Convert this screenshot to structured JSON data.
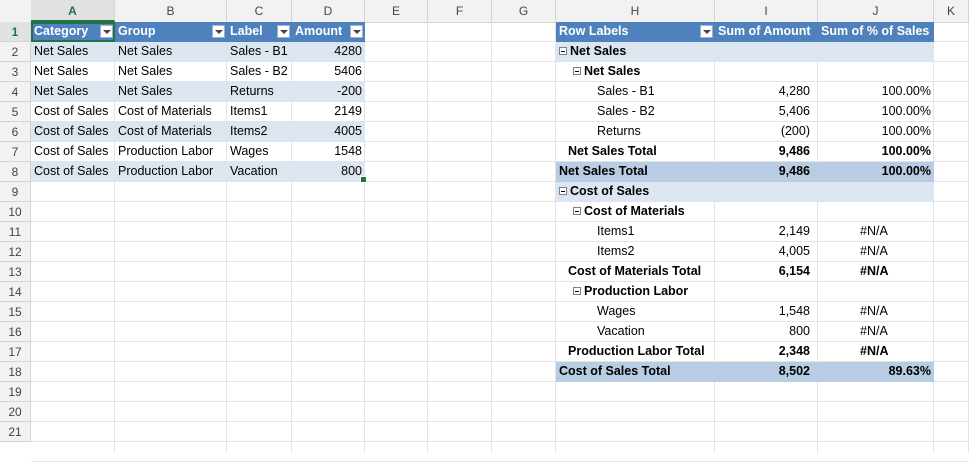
{
  "columns": [
    "A",
    "B",
    "C",
    "D",
    "E",
    "F",
    "G",
    "H",
    "I",
    "J",
    "K"
  ],
  "selected_column": "A",
  "rows": [
    "1",
    "2",
    "3",
    "4",
    "5",
    "6",
    "7",
    "8",
    "9",
    "10",
    "11",
    "12",
    "13",
    "14",
    "15",
    "16",
    "17",
    "18",
    "19",
    "20",
    "21"
  ],
  "selected_row": "1",
  "table": {
    "headers": [
      "Category",
      "Group",
      "Label",
      "Amount"
    ],
    "rows": [
      [
        "Net Sales",
        "Net Sales",
        "Sales - B1",
        "4280"
      ],
      [
        "Net Sales",
        "Net Sales",
        "Sales - B2",
        "5406"
      ],
      [
        "Net Sales",
        "Net Sales",
        "Returns",
        "-200"
      ],
      [
        "Cost of Sales",
        "Cost of Materials",
        "Items1",
        "2149"
      ],
      [
        "Cost of Sales",
        "Cost of Materials",
        "Items2",
        "4005"
      ],
      [
        "Cost of Sales",
        "Production Labor",
        "Wages",
        "1548"
      ],
      [
        "Cost of Sales",
        "Production Labor",
        "Vacation",
        "800"
      ]
    ]
  },
  "pivot": {
    "headers": [
      "Row Labels",
      "Sum of Amount",
      "Sum of % of Sales"
    ],
    "rows": [
      {
        "label": "Net Sales",
        "amount": "",
        "pct": "",
        "kind": "group"
      },
      {
        "label": "Net Sales",
        "amount": "",
        "pct": "",
        "kind": "subgroup"
      },
      {
        "label": "Sales - B1",
        "amount": "4,280",
        "pct": "100.00%",
        "kind": "item"
      },
      {
        "label": "Sales - B2",
        "amount": "5,406",
        "pct": "100.00%",
        "kind": "item"
      },
      {
        "label": "Returns",
        "amount": "(200)",
        "pct": "100.00%",
        "kind": "item"
      },
      {
        "label": "Net Sales Total",
        "amount": "9,486",
        "pct": "100.00%",
        "kind": "subtotal"
      },
      {
        "label": "Net Sales Total",
        "amount": "9,486",
        "pct": "100.00%",
        "kind": "total"
      },
      {
        "label": "Cost of Sales",
        "amount": "",
        "pct": "",
        "kind": "group"
      },
      {
        "label": "Cost of Materials",
        "amount": "",
        "pct": "",
        "kind": "subgroup"
      },
      {
        "label": "Items1",
        "amount": "2,149",
        "pct": "#N/A",
        "kind": "item"
      },
      {
        "label": "Items2",
        "amount": "4,005",
        "pct": "#N/A",
        "kind": "item"
      },
      {
        "label": "Cost of Materials Total",
        "amount": "6,154",
        "pct": "#N/A",
        "kind": "subtotal"
      },
      {
        "label": "Production Labor",
        "amount": "",
        "pct": "",
        "kind": "subgroup"
      },
      {
        "label": "Wages",
        "amount": "1,548",
        "pct": "#N/A",
        "kind": "item"
      },
      {
        "label": "Vacation",
        "amount": "800",
        "pct": "#N/A",
        "kind": "item"
      },
      {
        "label": "Production Labor Total",
        "amount": "2,348",
        "pct": "#N/A",
        "kind": "subtotal"
      },
      {
        "label": "Cost of Sales Total",
        "amount": "8,502",
        "pct": "89.63%",
        "kind": "total"
      }
    ]
  },
  "colors": {
    "table_header": "#4f81bd",
    "table_band": "#dce6f1",
    "pivot_total": "#b8cce4",
    "selection": "#217346"
  }
}
